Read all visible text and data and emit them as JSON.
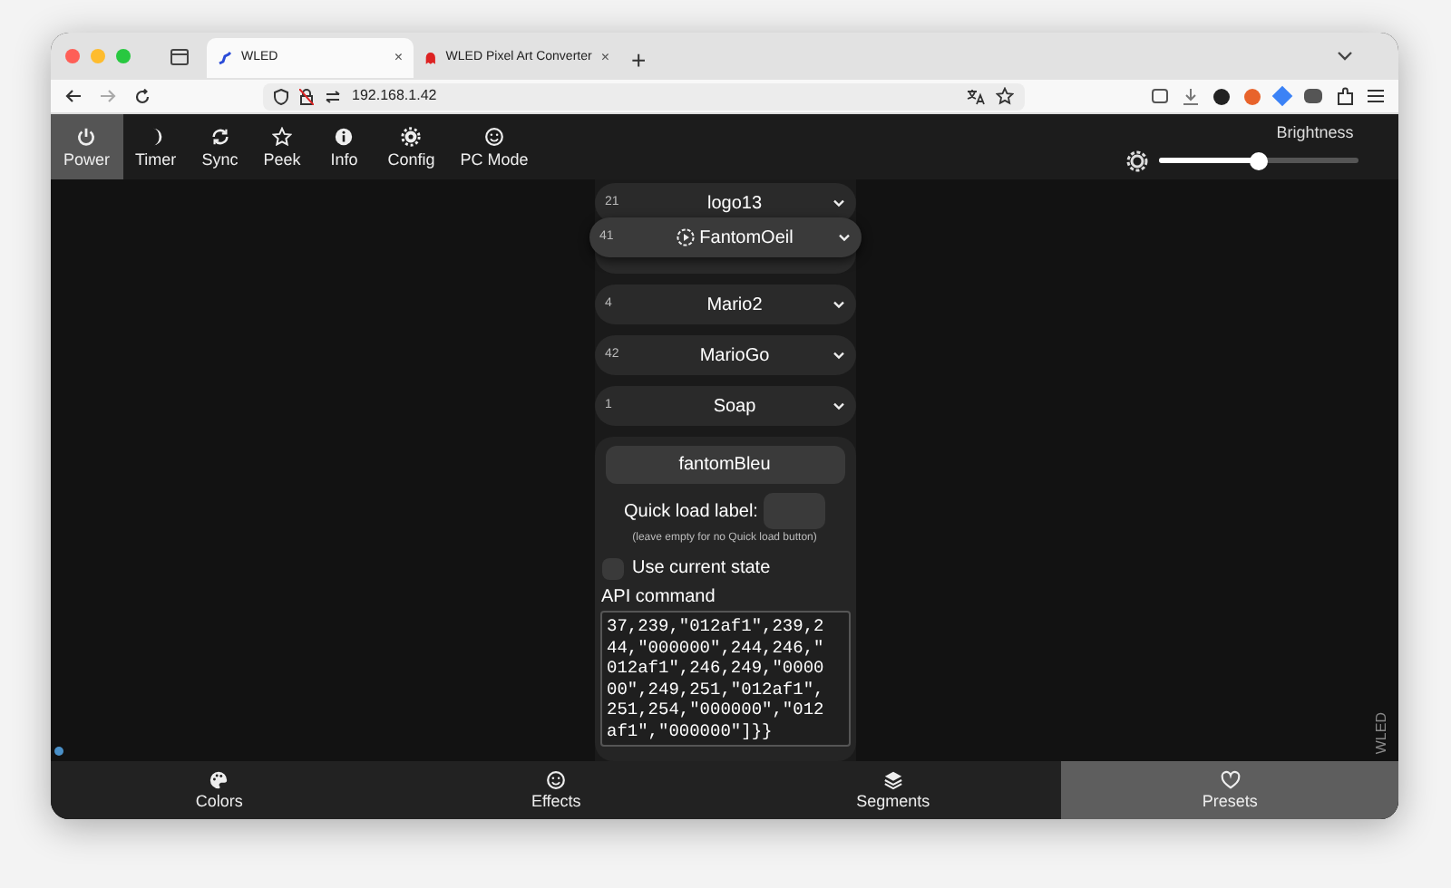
{
  "browser": {
    "tabs": [
      {
        "title": "WLED",
        "selected": true,
        "close": "×"
      },
      {
        "title": "WLED Pixel Art Converter",
        "selected": false,
        "close": "×"
      }
    ],
    "new_tab": "+",
    "address": "192.168.1.42"
  },
  "nav": [
    {
      "label": "Power",
      "selected": true
    },
    {
      "label": "Timer",
      "selected": false
    },
    {
      "label": "Sync",
      "selected": false
    },
    {
      "label": "Peek",
      "selected": false
    },
    {
      "label": "Info",
      "selected": false
    },
    {
      "label": "Config",
      "selected": false
    },
    {
      "label": "PC Mode",
      "selected": false
    }
  ],
  "brightness": {
    "label": "Brightness",
    "level": 0.5
  },
  "presets": [
    {
      "id": "21",
      "name": "logo13",
      "dragging": false
    },
    {
      "id": "41",
      "name": "FantomOeil",
      "dragging": true
    },
    {
      "id": "4",
      "name": "Mario2",
      "dragging": false
    },
    {
      "id": "42",
      "name": "MarioGo",
      "dragging": false
    },
    {
      "id": "1",
      "name": "Soap",
      "dragging": false
    }
  ],
  "editor": {
    "name": "fantomBleu",
    "quick_load_label": "Quick load label:",
    "quick_load_hint": "(leave empty for no Quick load button)",
    "use_current_state": {
      "label": "Use current state",
      "checked": false
    },
    "api_label": "API command",
    "api_command": [
      "37,239,\"012af1\",239,2",
      "44,\"000000\",244,246,\"",
      "012af1\",246,249,\"0000",
      "00\",249,251,\"012af1\",",
      "251,254,\"000000\",\"012",
      "af1\",\"000000\"]}}"
    ]
  },
  "side_label": "WLED",
  "bottom_tabs": [
    {
      "label": "Colors",
      "selected": false
    },
    {
      "label": "Effects",
      "selected": false
    },
    {
      "label": "Segments",
      "selected": false
    },
    {
      "label": "Presets",
      "selected": true
    }
  ]
}
